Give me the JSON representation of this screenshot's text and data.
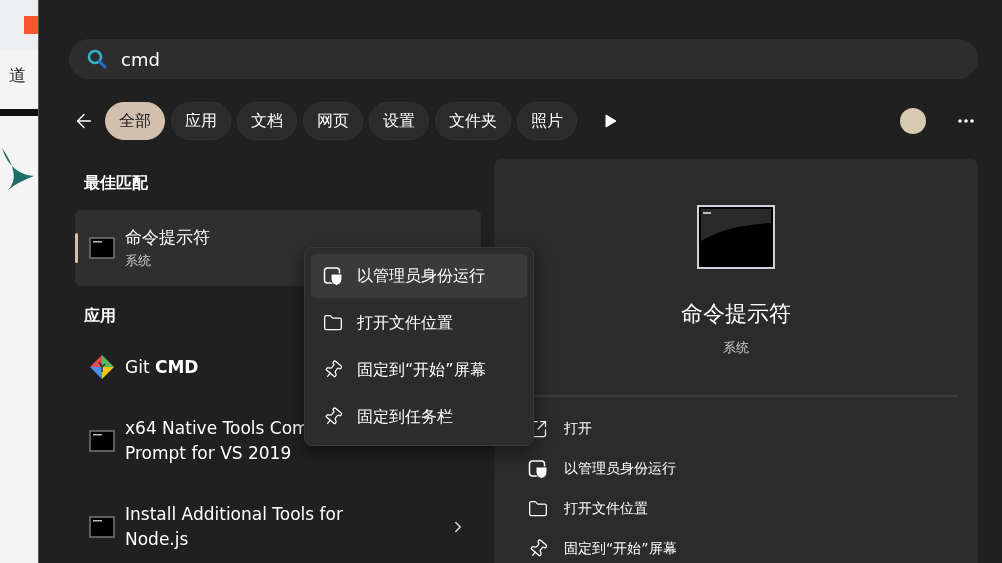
{
  "background_window": {
    "text": "道"
  },
  "search": {
    "value": "cmd"
  },
  "filters": [
    {
      "label": "全部",
      "selected": true
    },
    {
      "label": "应用",
      "selected": false
    },
    {
      "label": "文档",
      "selected": false
    },
    {
      "label": "网页",
      "selected": false
    },
    {
      "label": "设置",
      "selected": false
    },
    {
      "label": "文件夹",
      "selected": false
    },
    {
      "label": "照片",
      "selected": false
    }
  ],
  "best_match": {
    "heading": "最佳匹配",
    "item": {
      "title": "命令提示符",
      "subtitle": "系统",
      "selected": true
    }
  },
  "apps": {
    "heading": "应用",
    "items": [
      {
        "kind": "git",
        "lines": [
          "Git **CMD**"
        ],
        "has_arrow": false
      },
      {
        "kind": "console",
        "lines": [
          "x64 Native Tools Com",
          "Prompt for VS 2019"
        ],
        "has_arrow": false
      },
      {
        "kind": "console",
        "lines": [
          "Install Additional Tools for",
          "Node.js"
        ],
        "has_arrow": true
      }
    ]
  },
  "context_menu": [
    {
      "kind": "admin",
      "label": "以管理员身份运行",
      "selected": true
    },
    {
      "kind": "folder",
      "label": "打开文件位置",
      "selected": false
    },
    {
      "kind": "pin",
      "label": "固定到“开始”屏幕",
      "selected": false
    },
    {
      "kind": "pin",
      "label": "固定到任务栏",
      "selected": false
    }
  ],
  "details": {
    "title": "命令提示符",
    "subtitle": "系统",
    "actions": [
      {
        "kind": "open",
        "label": "打开"
      },
      {
        "kind": "admin",
        "label": "以管理员身份运行"
      },
      {
        "kind": "folder",
        "label": "打开文件位置"
      },
      {
        "kind": "pin",
        "label": "固定到“开始”屏幕"
      }
    ]
  }
}
